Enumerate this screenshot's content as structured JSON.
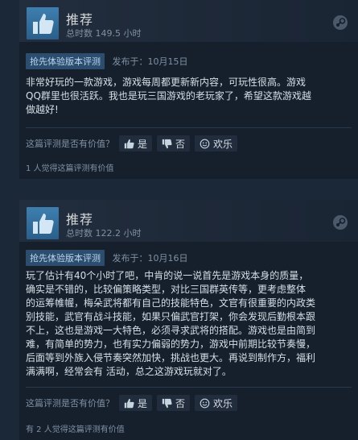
{
  "reviews": [
    {
      "recommendation": "推荐",
      "hours": "总时数 149.5 小时",
      "early_access_badge": "抢先体验版本评测",
      "posted": "发布于：10月15日",
      "body_lines": [
        "非常好玩的一款游戏，游戏每周都更新新内容，可玩性很高。游戏",
        "QQ群里也很活跃。我也是玩三国游戏的老玩家了，希望这款游戏越",
        "做越好!"
      ],
      "helpful_question": "这篇评测是否有价值？",
      "vote_yes": "是",
      "vote_no": "否",
      "vote_funny": "欢乐",
      "helpful_count": "1 人觉得这篇评测有价值"
    },
    {
      "recommendation": "推荐",
      "hours": "总时数 122.2 小时",
      "early_access_badge": "抢先体验版本评测",
      "posted": "发布于：10月16日",
      "body_lines": [
        "玩了估计有40个小时了吧，中肯的说一说首先是游戏本身的质量，",
        "确实是不错的，比较偏策略类型，对比三国群英传等，更考虑整体",
        "的运筹帷幄，梅朵武将都有自己的技能特色，文官有很重要的内政类",
        "别技能，武官有战斗技能，如果只偏武官打架，你会发现后勤根本跟",
        "不上，这也是游戏一大特色，必须寻求武将的搭配。游戏也是由简到",
        "难，有简单的势力，也有实力偏弱的势力，游戏中前期比较节奏慢，",
        "后面等到外族入侵节奏突然加快，挑战也更大。再说到制作方，福利",
        "满满啊，经常会有 活动，总之这游戏玩就对了。"
      ],
      "helpful_question": "这篇评测是否有价值？",
      "vote_yes": "是",
      "vote_no": "否",
      "vote_funny": "欢乐",
      "helpful_count": "有 2 人觉得这篇评测有价值"
    }
  ]
}
